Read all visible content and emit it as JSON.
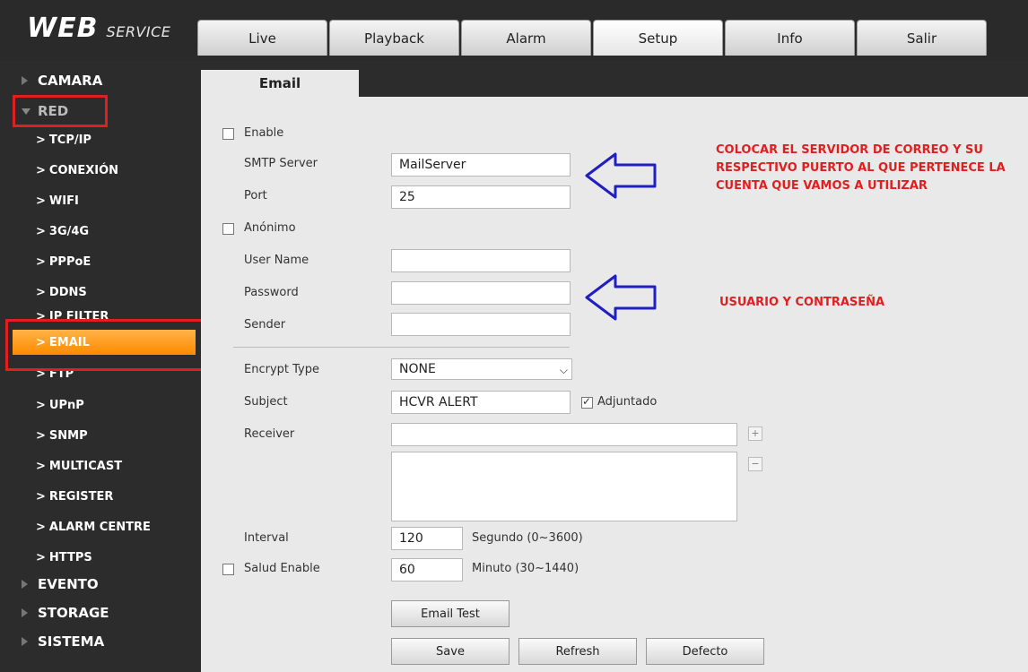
{
  "app": {
    "logo_main": "WEB",
    "logo_sub": "SERVICE"
  },
  "tabs": [
    "Live",
    "Playback",
    "Alarm",
    "Setup",
    "Info",
    "Salir"
  ],
  "sidebar": {
    "camara": "CAMARA",
    "red": "RED",
    "sub_items": [
      "TCP/IP",
      "CONEXIÓN",
      "WIFI",
      "3G/4G",
      "PPPoE",
      "DDNS",
      "IP FILTER",
      "EMAIL",
      "FTP",
      "UPnP",
      "SNMP",
      "MULTICAST",
      "REGISTER",
      "ALARM CENTRE",
      "HTTPS"
    ],
    "evento": "EVENTO",
    "storage": "STORAGE",
    "sistema": "SISTEMA",
    "chevron": ">"
  },
  "page_tab": "Email",
  "form": {
    "enable_label": "Enable",
    "smtp_label": "SMTP Server",
    "smtp_value": "MailServer",
    "port_label": "Port",
    "port_value": "25",
    "anon_label": "Anónimo",
    "user_label": "User Name",
    "user_value": "",
    "password_label": "Password",
    "password_value": "",
    "sender_label": "Sender",
    "sender_value": "",
    "encrypt_label": "Encrypt Type",
    "encrypt_value": "NONE",
    "subject_label": "Subject",
    "subject_value": "HCVR ALERT",
    "attach_label": "Adjuntado",
    "receiver_label": "Receiver",
    "receiver_value": "",
    "interval_label": "Interval",
    "interval_value": "120",
    "interval_unit": "Segundo (0~3600)",
    "health_label": "Salud Enable",
    "health_value": "60",
    "health_unit": "Minuto (30~1440)",
    "plus": "+",
    "minus": "−"
  },
  "buttons": {
    "email_test": "Email Test",
    "save": "Save",
    "refresh": "Refresh",
    "default": "Defecto"
  },
  "annotations": {
    "server_note": "COLOCAR EL SERVIDOR DE CORREO Y SU RESPECTIVO PUERTO AL QUE PERTENECE LA CUENTA QUE VAMOS A UTILIZAR",
    "user_note": "USUARIO Y CONTRASEÑA"
  },
  "colors": {
    "highlight": "#ff8a00",
    "annotation_red": "#e02020",
    "arrow_blue": "#2020c0"
  }
}
